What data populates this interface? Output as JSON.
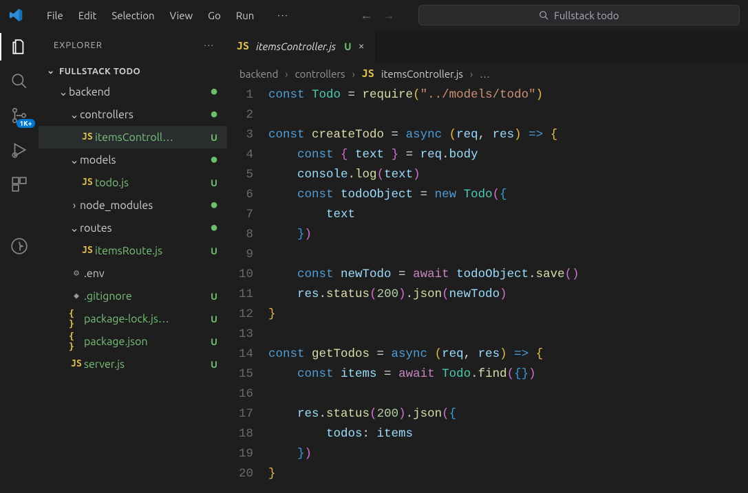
{
  "menu": {
    "items": [
      "File",
      "Edit",
      "Selection",
      "View",
      "Go",
      "Run"
    ],
    "ellipsis": "···"
  },
  "search": {
    "placeholder": "Fullstack todo"
  },
  "activity": {
    "explorer": "Explorer",
    "search": "Search",
    "scm": "Source Control",
    "scm_badge": "1K+",
    "debug": "Run and Debug",
    "ext": "Extensions",
    "account": "Accounts"
  },
  "explorer": {
    "title": "EXPLORER",
    "root": "FULLSTACK TODO",
    "more": "···",
    "tree": [
      {
        "type": "folder",
        "label": "backend",
        "depth": 1,
        "state": "expanded",
        "status": "dot"
      },
      {
        "type": "folder",
        "label": "controllers",
        "depth": 2,
        "state": "expanded",
        "status": "dot"
      },
      {
        "type": "file",
        "label": "itemsControll…",
        "depth": 3,
        "icon": "js",
        "status": "U",
        "green": true,
        "selected": true
      },
      {
        "type": "folder",
        "label": "models",
        "depth": 2,
        "state": "expanded",
        "status": "dot"
      },
      {
        "type": "file",
        "label": "todo.js",
        "depth": 3,
        "icon": "js",
        "status": "U",
        "green": true
      },
      {
        "type": "folder",
        "label": "node_modules",
        "depth": 2,
        "state": "collapsed",
        "status": "dot"
      },
      {
        "type": "folder",
        "label": "routes",
        "depth": 2,
        "state": "expanded",
        "status": "dot"
      },
      {
        "type": "file",
        "label": "itemsRoute.js",
        "depth": 3,
        "icon": "js",
        "status": "U",
        "green": true
      },
      {
        "type": "file",
        "label": ".env",
        "depth": 2,
        "icon": "gear",
        "status": ""
      },
      {
        "type": "file",
        "label": ".gitignore",
        "depth": 2,
        "icon": "diam",
        "status": "U",
        "green": true
      },
      {
        "type": "file",
        "label": "package-lock.js…",
        "depth": 2,
        "icon": "json",
        "status": "U",
        "green": true
      },
      {
        "type": "file",
        "label": "package.json",
        "depth": 2,
        "icon": "json",
        "status": "U",
        "green": true
      },
      {
        "type": "file",
        "label": "server.js",
        "depth": 2,
        "icon": "js",
        "status": "U",
        "green": true
      }
    ]
  },
  "tab": {
    "icon": "JS",
    "name": "itemsController.js",
    "git": "U",
    "close": "×"
  },
  "breadcrumbs": {
    "parts": [
      "backend",
      "controllers"
    ],
    "fileIcon": "JS",
    "file": "itemsController.js",
    "ellipsis": "…"
  },
  "code": {
    "lines": [
      [
        {
          "c": "tk-kw",
          "t": "const "
        },
        {
          "c": "tk-cls",
          "t": "Todo"
        },
        {
          "c": "tk-pun",
          "t": " = "
        },
        {
          "c": "tk-fn",
          "t": "require"
        },
        {
          "c": "tk-par",
          "t": "("
        },
        {
          "c": "tk-str",
          "t": "\"../models/todo\""
        },
        {
          "c": "tk-par",
          "t": ")"
        }
      ],
      [],
      [
        {
          "c": "tk-kw",
          "t": "const "
        },
        {
          "c": "tk-fn",
          "t": "createTodo"
        },
        {
          "c": "tk-pun",
          "t": " = "
        },
        {
          "c": "tk-kw",
          "t": "async "
        },
        {
          "c": "tk-par",
          "t": "("
        },
        {
          "c": "tk-var",
          "t": "req"
        },
        {
          "c": "tk-pun",
          "t": ", "
        },
        {
          "c": "tk-var",
          "t": "res"
        },
        {
          "c": "tk-par",
          "t": ")"
        },
        {
          "c": "tk-pun",
          "t": " "
        },
        {
          "c": "tk-kw",
          "t": "=>"
        },
        {
          "c": "tk-pun",
          "t": " "
        },
        {
          "c": "tk-par",
          "t": "{"
        }
      ],
      [
        {
          "c": "tk-pun",
          "t": "    "
        },
        {
          "c": "tk-kw",
          "t": "const "
        },
        {
          "c": "tk-par2",
          "t": "{ "
        },
        {
          "c": "tk-var",
          "t": "text"
        },
        {
          "c": "tk-par2",
          "t": " }"
        },
        {
          "c": "tk-pun",
          "t": " = "
        },
        {
          "c": "tk-var",
          "t": "req"
        },
        {
          "c": "tk-pun",
          "t": "."
        },
        {
          "c": "tk-prop",
          "t": "body"
        }
      ],
      [
        {
          "c": "tk-pun",
          "t": "    "
        },
        {
          "c": "tk-var",
          "t": "console"
        },
        {
          "c": "tk-pun",
          "t": "."
        },
        {
          "c": "tk-fn",
          "t": "log"
        },
        {
          "c": "tk-par2",
          "t": "("
        },
        {
          "c": "tk-var",
          "t": "text"
        },
        {
          "c": "tk-par2",
          "t": ")"
        }
      ],
      [
        {
          "c": "tk-pun",
          "t": "    "
        },
        {
          "c": "tk-kw",
          "t": "const "
        },
        {
          "c": "tk-var",
          "t": "todoObject"
        },
        {
          "c": "tk-pun",
          "t": " = "
        },
        {
          "c": "tk-kw",
          "t": "new "
        },
        {
          "c": "tk-cls",
          "t": "Todo"
        },
        {
          "c": "tk-par2",
          "t": "("
        },
        {
          "c": "tk-par3",
          "t": "{"
        }
      ],
      [
        {
          "c": "tk-pun",
          "t": "        "
        },
        {
          "c": "tk-var",
          "t": "text"
        }
      ],
      [
        {
          "c": "tk-pun",
          "t": "    "
        },
        {
          "c": "tk-par3",
          "t": "}"
        },
        {
          "c": "tk-par2",
          "t": ")"
        }
      ],
      [],
      [
        {
          "c": "tk-pun",
          "t": "    "
        },
        {
          "c": "tk-kw",
          "t": "const "
        },
        {
          "c": "tk-var",
          "t": "newTodo"
        },
        {
          "c": "tk-pun",
          "t": " = "
        },
        {
          "c": "tk-ctl",
          "t": "await "
        },
        {
          "c": "tk-var",
          "t": "todoObject"
        },
        {
          "c": "tk-pun",
          "t": "."
        },
        {
          "c": "tk-fn",
          "t": "save"
        },
        {
          "c": "tk-par2",
          "t": "()"
        }
      ],
      [
        {
          "c": "tk-pun",
          "t": "    "
        },
        {
          "c": "tk-var",
          "t": "res"
        },
        {
          "c": "tk-pun",
          "t": "."
        },
        {
          "c": "tk-fn",
          "t": "status"
        },
        {
          "c": "tk-par2",
          "t": "("
        },
        {
          "c": "tk-num",
          "t": "200"
        },
        {
          "c": "tk-par2",
          "t": ")"
        },
        {
          "c": "tk-pun",
          "t": "."
        },
        {
          "c": "tk-fn",
          "t": "json"
        },
        {
          "c": "tk-par2",
          "t": "("
        },
        {
          "c": "tk-var",
          "t": "newTodo"
        },
        {
          "c": "tk-par2",
          "t": ")"
        }
      ],
      [
        {
          "c": "tk-par",
          "t": "}"
        }
      ],
      [],
      [
        {
          "c": "tk-kw",
          "t": "const "
        },
        {
          "c": "tk-fn",
          "t": "getTodos"
        },
        {
          "c": "tk-pun",
          "t": " = "
        },
        {
          "c": "tk-kw",
          "t": "async "
        },
        {
          "c": "tk-par",
          "t": "("
        },
        {
          "c": "tk-var",
          "t": "req"
        },
        {
          "c": "tk-pun",
          "t": ", "
        },
        {
          "c": "tk-var",
          "t": "res"
        },
        {
          "c": "tk-par",
          "t": ")"
        },
        {
          "c": "tk-pun",
          "t": " "
        },
        {
          "c": "tk-kw",
          "t": "=>"
        },
        {
          "c": "tk-pun",
          "t": " "
        },
        {
          "c": "tk-par",
          "t": "{"
        }
      ],
      [
        {
          "c": "tk-pun",
          "t": "    "
        },
        {
          "c": "tk-kw",
          "t": "const "
        },
        {
          "c": "tk-var",
          "t": "items"
        },
        {
          "c": "tk-pun",
          "t": " = "
        },
        {
          "c": "tk-ctl",
          "t": "await "
        },
        {
          "c": "tk-cls",
          "t": "Todo"
        },
        {
          "c": "tk-pun",
          "t": "."
        },
        {
          "c": "tk-fn",
          "t": "find"
        },
        {
          "c": "tk-par2",
          "t": "("
        },
        {
          "c": "tk-par3",
          "t": "{}"
        },
        {
          "c": "tk-par2",
          "t": ")"
        }
      ],
      [],
      [
        {
          "c": "tk-pun",
          "t": "    "
        },
        {
          "c": "tk-var",
          "t": "res"
        },
        {
          "c": "tk-pun",
          "t": "."
        },
        {
          "c": "tk-fn",
          "t": "status"
        },
        {
          "c": "tk-par2",
          "t": "("
        },
        {
          "c": "tk-num",
          "t": "200"
        },
        {
          "c": "tk-par2",
          "t": ")"
        },
        {
          "c": "tk-pun",
          "t": "."
        },
        {
          "c": "tk-fn",
          "t": "json"
        },
        {
          "c": "tk-par2",
          "t": "("
        },
        {
          "c": "tk-par3",
          "t": "{"
        }
      ],
      [
        {
          "c": "tk-pun",
          "t": "        "
        },
        {
          "c": "tk-prop",
          "t": "todos"
        },
        {
          "c": "tk-pun",
          "t": ": "
        },
        {
          "c": "tk-var",
          "t": "items"
        }
      ],
      [
        {
          "c": "tk-pun",
          "t": "    "
        },
        {
          "c": "tk-par3",
          "t": "}"
        },
        {
          "c": "tk-par2",
          "t": ")"
        }
      ],
      [
        {
          "c": "tk-par",
          "t": "}"
        }
      ]
    ]
  }
}
